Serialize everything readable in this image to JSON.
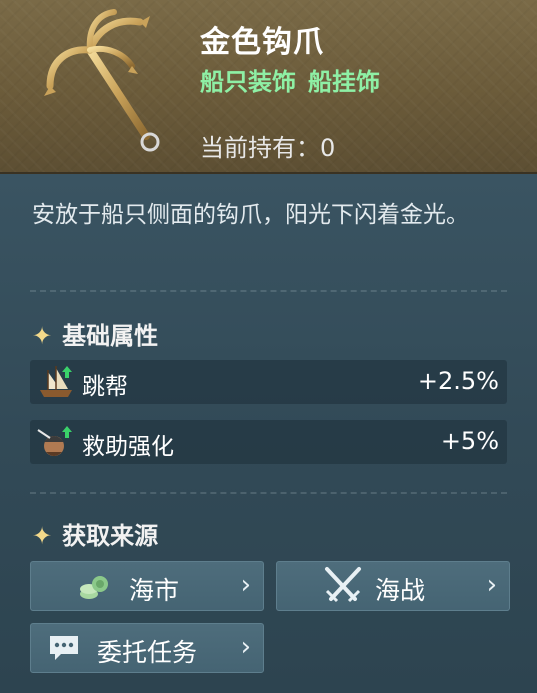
{
  "item": {
    "name": "金色钩爪",
    "tags": [
      "船只装饰",
      "船挂饰"
    ],
    "owned_label": "当前持有：",
    "owned_count": "0",
    "description": "安放于船只侧面的钩爪，阳光下闪着金光。",
    "icon": "golden-grappling-hook-icon"
  },
  "base_attributes": {
    "title": "基础属性",
    "items": [
      {
        "label": "跳帮",
        "value": "+2.5%",
        "icon": "boarding-ship-icon"
      },
      {
        "label": "救助强化",
        "value": "+5%",
        "icon": "rescue-sailor-icon"
      }
    ]
  },
  "sources": {
    "title": "获取来源",
    "buttons": [
      {
        "label": "海市",
        "icon": "coins-icon"
      },
      {
        "label": "海战",
        "icon": "crossed-swords-icon"
      },
      {
        "label": "委托任务",
        "icon": "chat-bubble-icon"
      }
    ]
  },
  "colors": {
    "header_bg": "#6b5b3a",
    "panel_bg": "#324a57",
    "tag_green": "#8ef0a5",
    "star_gold": "#f3d98a",
    "button_bg": "#4e6d7c"
  }
}
